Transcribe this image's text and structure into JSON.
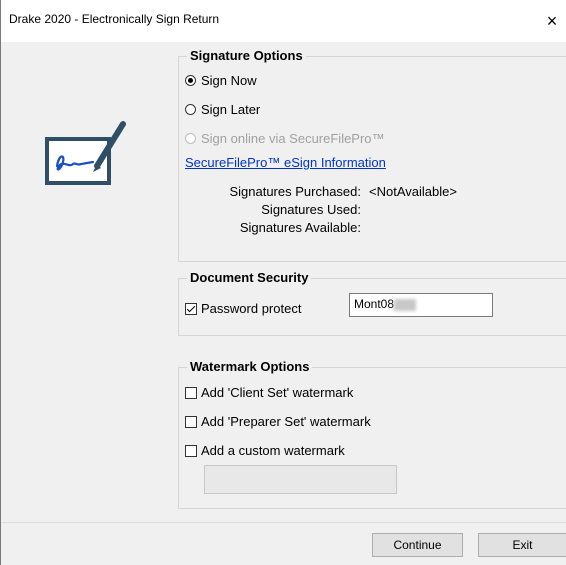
{
  "window": {
    "title": "Drake 2020 - Electronically Sign Return",
    "close_glyph": "×"
  },
  "signature_options": {
    "title": "Signature Options",
    "sign_now": "Sign Now",
    "sign_later": "Sign Later",
    "sign_online": "Sign online via SecureFilePro™",
    "esign_link": "SecureFilePro™ eSign Information",
    "purchased_label": "Signatures Purchased:",
    "purchased_value": "<NotAvailable>",
    "used_label": "Signatures Used:",
    "available_label": "Signatures Available:"
  },
  "document_security": {
    "title": "Document Security",
    "password_protect": "Password protect",
    "password_value": "Mont08"
  },
  "watermark_options": {
    "title": "Watermark Options",
    "client_set": "Add 'Client Set' watermark",
    "preparer_set": "Add 'Preparer Set' watermark",
    "custom": "Add a custom watermark",
    "custom_value": ""
  },
  "buttons": {
    "continue": "Continue",
    "exit": "Exit"
  },
  "icons": {
    "logo": "esign-pen-tablet-icon",
    "close": "close-icon"
  }
}
